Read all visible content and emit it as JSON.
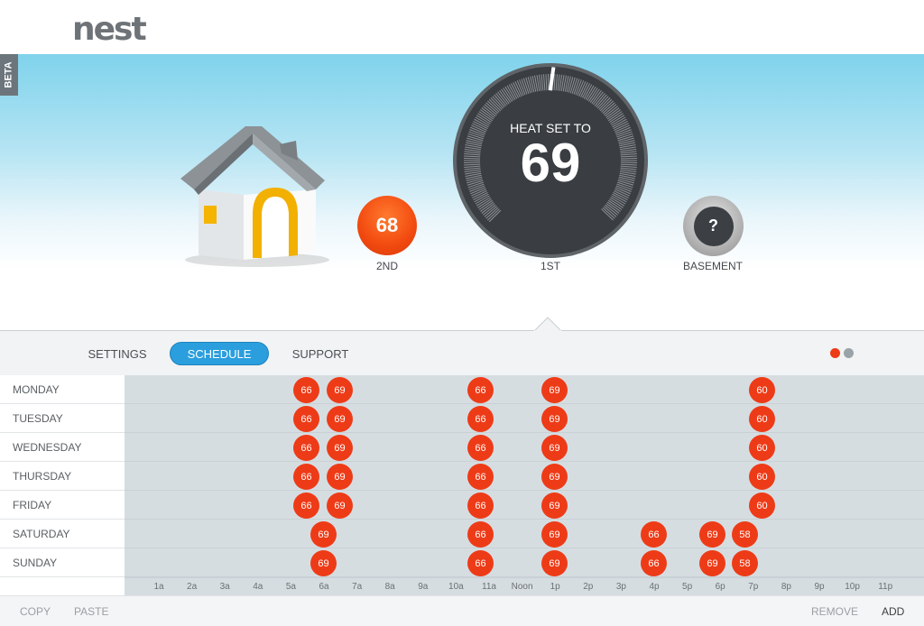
{
  "brand": {
    "logo": "nest",
    "beta": "BETA"
  },
  "zones": [
    {
      "label": "2ND",
      "temp": "68",
      "color": "#f24a10"
    },
    {
      "label": "1ST",
      "mode_text": "HEAT SET TO",
      "temp": "69"
    },
    {
      "label": "BASEMENT",
      "temp": "?"
    }
  ],
  "tabs": [
    {
      "label": "SETTINGS",
      "active": false
    },
    {
      "label": "SCHEDULE",
      "active": true
    },
    {
      "label": "SUPPORT",
      "active": false
    }
  ],
  "pager": {
    "colors": [
      "#ee3b17",
      "#9aa3a8"
    ]
  },
  "schedule": {
    "days": [
      {
        "label": "MONDAY",
        "points": [
          {
            "t": "6a-",
            "v": "66"
          },
          {
            "t": "6a+",
            "v": "69"
          },
          {
            "t": "11a",
            "v": "66"
          },
          {
            "t": "1p",
            "v": "69"
          },
          {
            "t": "7p",
            "v": "60"
          }
        ]
      },
      {
        "label": "TUESDAY",
        "points": [
          {
            "t": "6a-",
            "v": "66"
          },
          {
            "t": "6a+",
            "v": "69"
          },
          {
            "t": "11a",
            "v": "66"
          },
          {
            "t": "1p",
            "v": "69"
          },
          {
            "t": "7p",
            "v": "60"
          }
        ]
      },
      {
        "label": "WEDNESDAY",
        "points": [
          {
            "t": "6a-",
            "v": "66"
          },
          {
            "t": "6a+",
            "v": "69"
          },
          {
            "t": "11a",
            "v": "66"
          },
          {
            "t": "1p",
            "v": "69"
          },
          {
            "t": "7p",
            "v": "60"
          }
        ]
      },
      {
        "label": "THURSDAY",
        "points": [
          {
            "t": "6a-",
            "v": "66"
          },
          {
            "t": "6a+",
            "v": "69"
          },
          {
            "t": "11a",
            "v": "66"
          },
          {
            "t": "1p",
            "v": "69"
          },
          {
            "t": "7p",
            "v": "60"
          }
        ]
      },
      {
        "label": "FRIDAY",
        "points": [
          {
            "t": "6a-",
            "v": "66"
          },
          {
            "t": "6a+",
            "v": "69"
          },
          {
            "t": "11a",
            "v": "66"
          },
          {
            "t": "1p",
            "v": "69"
          },
          {
            "t": "7p",
            "v": "60"
          }
        ]
      },
      {
        "label": "SATURDAY",
        "points": [
          {
            "t": "6a",
            "v": "69"
          },
          {
            "t": "11a",
            "v": "66"
          },
          {
            "t": "1p",
            "v": "69"
          },
          {
            "t": "4p",
            "v": "66"
          },
          {
            "t": "6p",
            "v": "69"
          },
          {
            "t": "7p-",
            "v": "58"
          }
        ]
      },
      {
        "label": "SUNDAY",
        "points": [
          {
            "t": "6a",
            "v": "69"
          },
          {
            "t": "11a",
            "v": "66"
          },
          {
            "t": "1p",
            "v": "69"
          },
          {
            "t": "4p",
            "v": "66"
          },
          {
            "t": "6p",
            "v": "69"
          },
          {
            "t": "7p-",
            "v": "58"
          }
        ]
      }
    ],
    "hours": [
      "1a",
      "2a",
      "3a",
      "4a",
      "5a",
      "6a",
      "7a",
      "8a",
      "9a",
      "10a",
      "11a",
      "Noon",
      "1p",
      "2p",
      "3p",
      "4p",
      "5p",
      "6p",
      "7p",
      "8p",
      "9p",
      "10p",
      "11p"
    ]
  },
  "footer": {
    "copy": "COPY",
    "paste": "PASTE",
    "remove": "REMOVE",
    "add": "ADD"
  }
}
